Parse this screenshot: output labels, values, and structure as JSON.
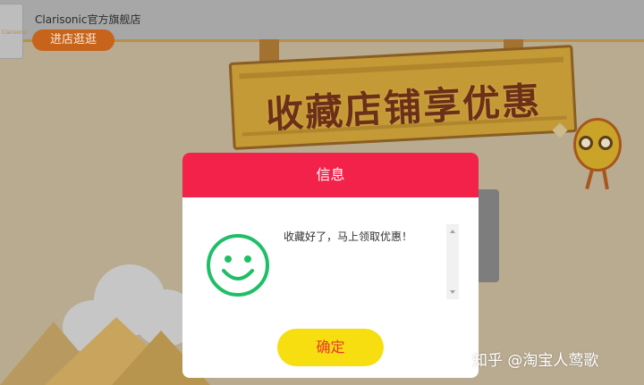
{
  "shop": {
    "logo_text": "Clarisonic",
    "name": "Clarisonic官方旗舰店",
    "enter_button": "进店逛逛"
  },
  "banner": {
    "title": "收藏店铺享优惠"
  },
  "dialog": {
    "title": "信息",
    "message": "收藏好了，马上领取优惠！",
    "confirm_label": "确定",
    "icon": "smiley-face-icon"
  },
  "watermark": "知乎 @淘宝人莺歌",
  "colors": {
    "header_red": "#f2224b",
    "confirm_yellow": "#f6de11",
    "confirm_text": "#e7382b",
    "smiley_green": "#1fbf68"
  }
}
